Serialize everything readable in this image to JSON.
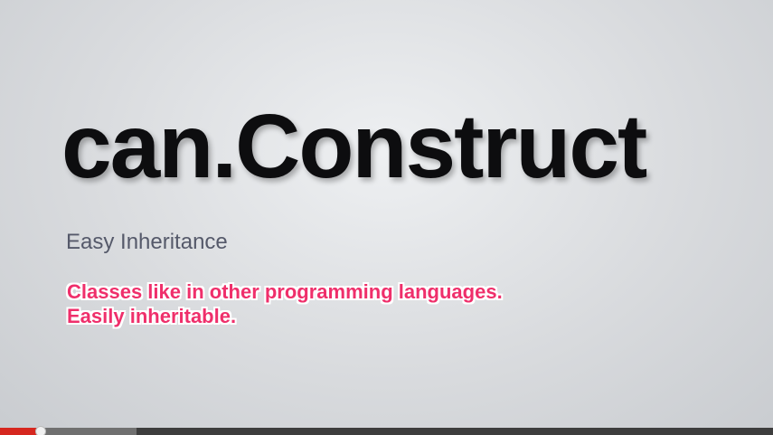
{
  "slide": {
    "title": "can.Construct",
    "subtitle": "Easy Inheritance",
    "caption_lines": [
      "Classes like in other programming languages.",
      "Easily inheritable."
    ]
  },
  "player": {
    "progress_played_fraction": 0.053,
    "progress_buffered_fraction": 0.177,
    "colors": {
      "played": "#d6271f",
      "buffered": "#707070",
      "track": "#3d3d3d",
      "caption": "#ef2f6b"
    }
  }
}
